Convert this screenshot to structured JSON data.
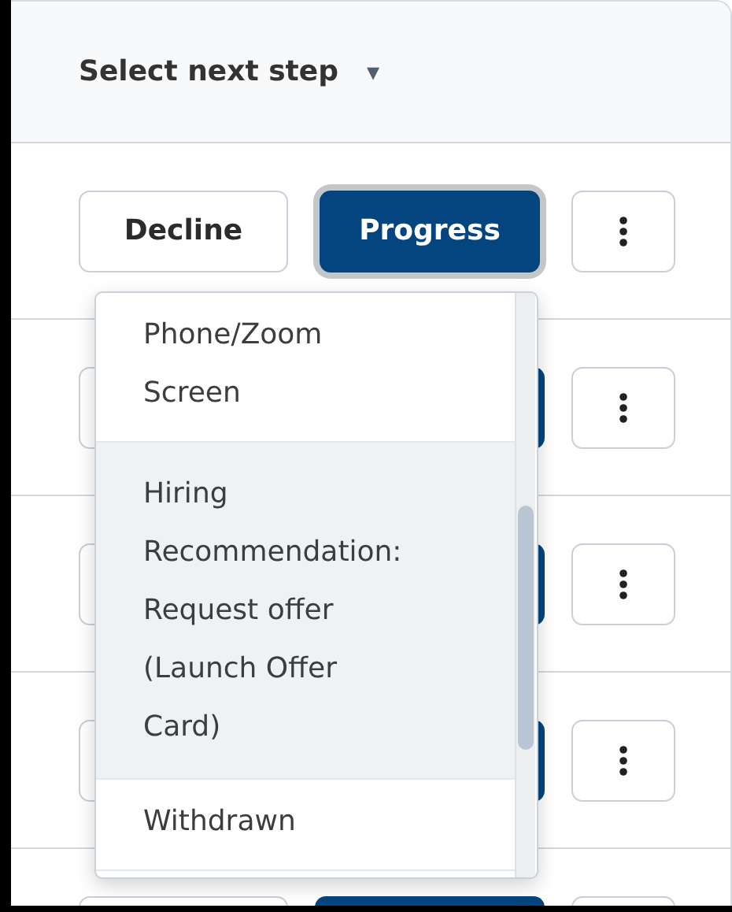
{
  "header": {
    "label": "Select next step",
    "caret": "▾"
  },
  "rows": [
    {
      "decline": {
        "label": "Decline"
      },
      "progress": {
        "label": "Progress",
        "focused": true
      },
      "more": true
    },
    {
      "decline": {},
      "progress": {
        "focused": false
      },
      "more": true
    },
    {
      "decline": {},
      "progress": {
        "focused": false
      },
      "more": true
    },
    {
      "decline": {},
      "progress": {
        "focused": false
      },
      "more": true
    },
    {
      "decline": {},
      "progress": {
        "focused": false
      },
      "more": true
    }
  ],
  "menu": {
    "items": [
      {
        "label": "Phone/Zoom Screen",
        "highlighted": false
      },
      {
        "label": "Hiring Recommendation: Request offer (Launch Offer Card)",
        "highlighted": true
      },
      {
        "label": "Withdrawn",
        "highlighted": false
      }
    ]
  }
}
